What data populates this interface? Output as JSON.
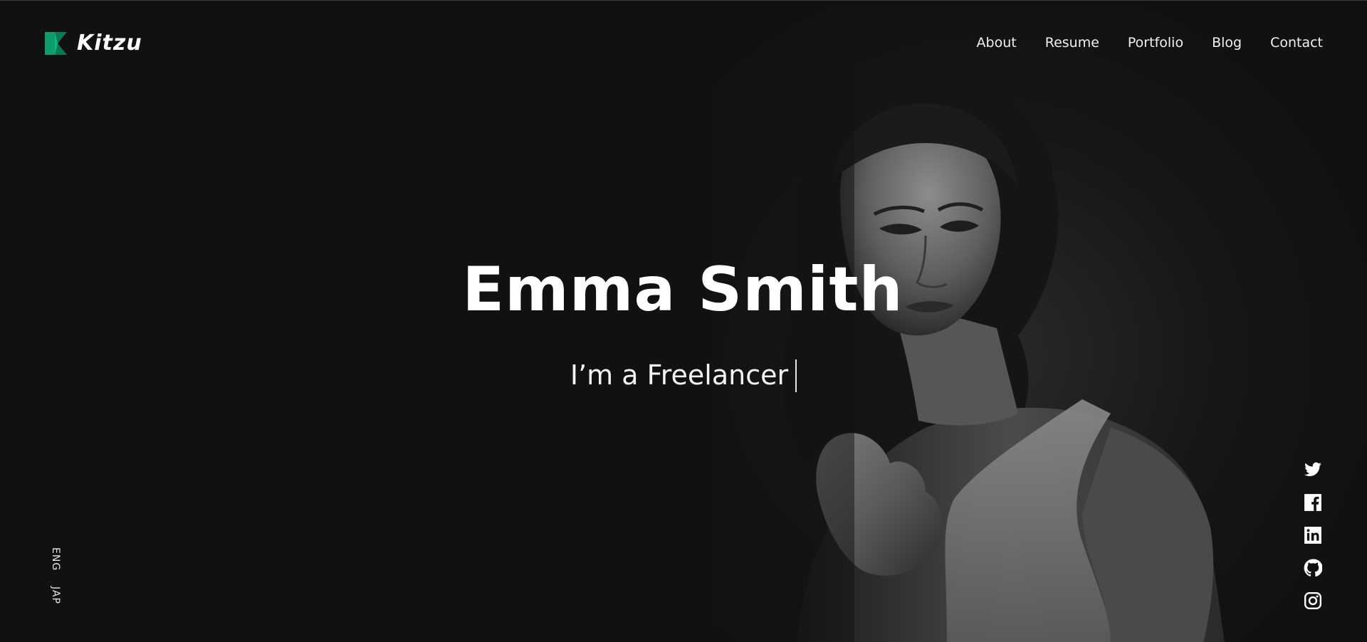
{
  "brand": {
    "name": "Kitzu",
    "accent_color": "#0f9d6b",
    "logo_icon": "kitzu-logo-icon"
  },
  "nav": {
    "items": [
      {
        "label": "About"
      },
      {
        "label": "Resume"
      },
      {
        "label": "Portfolio"
      },
      {
        "label": "Blog"
      },
      {
        "label": "Contact"
      }
    ]
  },
  "hero": {
    "name": "Emma Smith",
    "subtitle": "I’m a Freelancer",
    "background_color": "#111112",
    "photo_icon": "portrait-photo"
  },
  "languages": {
    "items": [
      {
        "label": "ENG"
      },
      {
        "label": "JAP"
      }
    ]
  },
  "social": {
    "items": [
      {
        "icon": "twitter-icon"
      },
      {
        "icon": "facebook-icon"
      },
      {
        "icon": "linkedin-icon"
      },
      {
        "icon": "github-icon"
      },
      {
        "icon": "instagram-icon"
      }
    ]
  }
}
